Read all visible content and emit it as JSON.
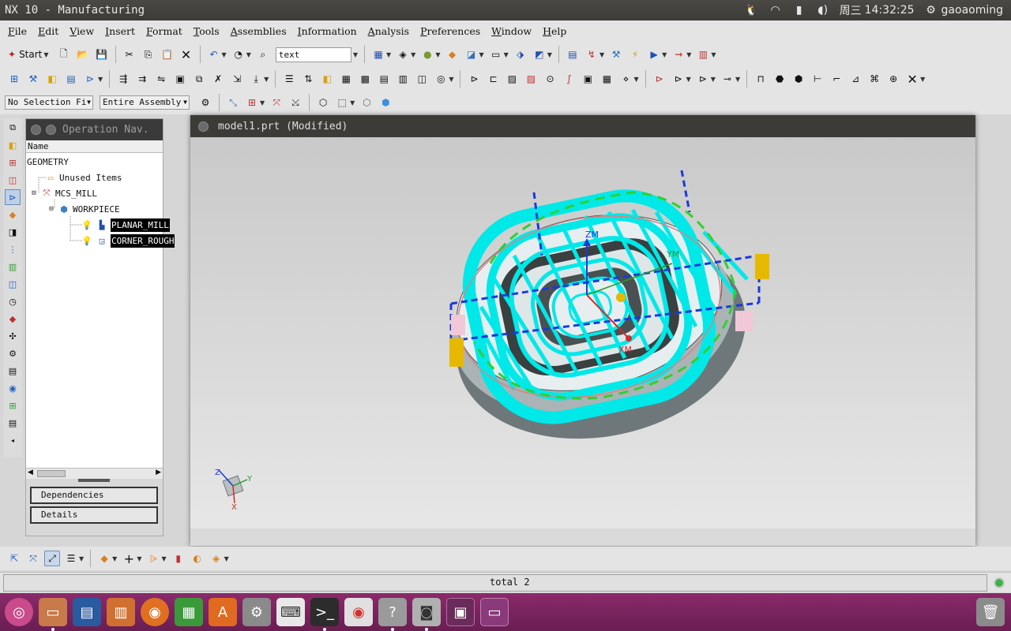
{
  "window": {
    "title": "NX 10 - Manufacturing"
  },
  "system_tray": {
    "day": "周三",
    "time": "14:32:25",
    "user": "gaoaoming"
  },
  "menu": [
    "File",
    "Edit",
    "View",
    "Insert",
    "Format",
    "Tools",
    "Assemblies",
    "Information",
    "Analysis",
    "Preferences",
    "Window",
    "Help"
  ],
  "toolbar": {
    "start_label": "Start",
    "text_box_value": "text"
  },
  "selection_bar": {
    "filter": "No Selection Fi",
    "scope": "Entire Assembly"
  },
  "navigator": {
    "title": "Operation Nav.",
    "column_name": "Name",
    "tree": {
      "root": "GEOMETRY",
      "unused": "Unused Items",
      "mcs": "MCS_MILL",
      "workpiece": "WORKPIECE",
      "op1": "PLANAR_MILL",
      "op2": "CORNER_ROUGH"
    },
    "dependencies_label": "Dependencies",
    "details_label": "Details"
  },
  "graphics_window": {
    "title": "model1.prt (Modified)",
    "axes": {
      "zm": "ZM",
      "ym": "YM",
      "xm": "XM",
      "triad_x": "X",
      "triad_y": "Y",
      "triad_z": "Z"
    }
  },
  "status": {
    "text": "total 2"
  },
  "colors": {
    "toolpath": "#00e8e8",
    "part": "#e8eef0",
    "mcs_blue": "#1a3ad8",
    "mcs_red": "#d42a2a",
    "launcher": "#7a2460"
  }
}
